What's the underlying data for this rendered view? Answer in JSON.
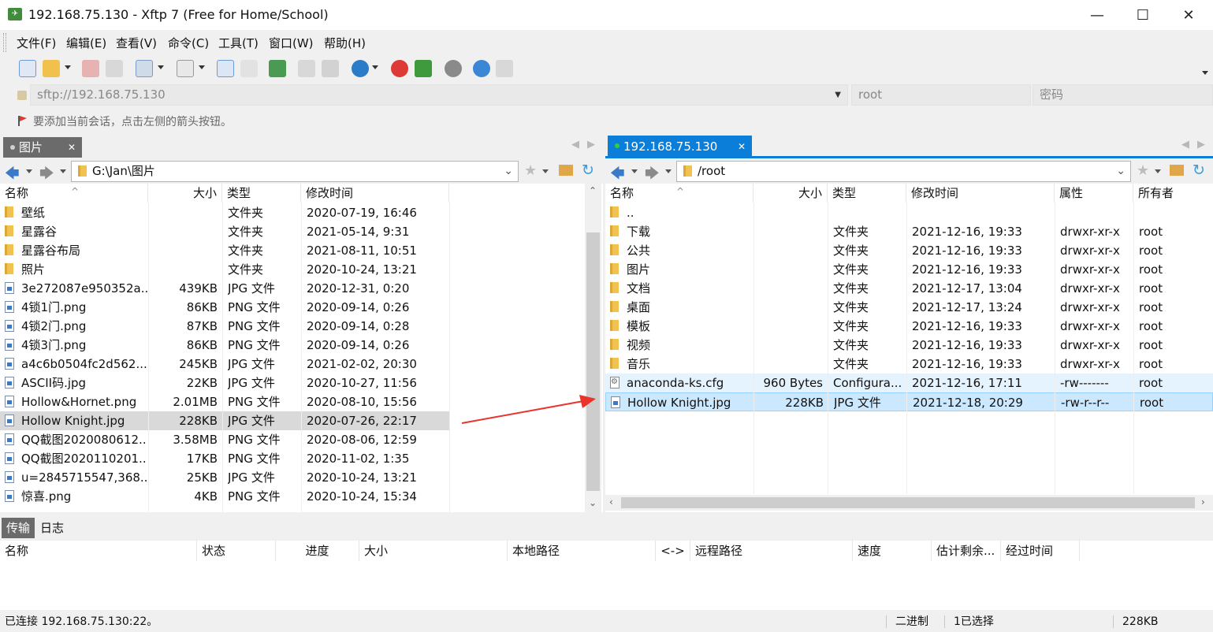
{
  "window": {
    "title": "192.168.75.130 - Xftp 7 (Free for Home/School)",
    "app_icon": "xftp-app-icon"
  },
  "menu": [
    "文件(F)",
    "编辑(E)",
    "查看(V)",
    "命令(C)",
    "工具(T)",
    "窗口(W)",
    "帮助(H)"
  ],
  "address": {
    "url": "sftp://192.168.75.130",
    "user": "root",
    "password_placeholder": "密码"
  },
  "hint": "要添加当前会话，点击左侧的箭头按钮。",
  "left": {
    "tab": "图片",
    "path": "G:\\Jan\\图片",
    "columns": [
      "名称",
      "大小",
      "类型",
      "修改时间"
    ],
    "rows": [
      {
        "icon": "folder",
        "name": "壁纸",
        "size": "",
        "type": "文件夹",
        "time": "2020-07-19, 16:46"
      },
      {
        "icon": "folder",
        "name": "星露谷",
        "size": "",
        "type": "文件夹",
        "time": "2021-05-14, 9:31"
      },
      {
        "icon": "folder",
        "name": "星露谷布局",
        "size": "",
        "type": "文件夹",
        "time": "2021-08-11, 10:51"
      },
      {
        "icon": "folder",
        "name": "照片",
        "size": "",
        "type": "文件夹",
        "time": "2020-10-24, 13:21"
      },
      {
        "icon": "file",
        "name": "3e272087e950352a...",
        "size": "439KB",
        "type": "JPG 文件",
        "time": "2020-12-31, 0:20"
      },
      {
        "icon": "file",
        "name": "4锁1门.png",
        "size": "86KB",
        "type": "PNG 文件",
        "time": "2020-09-14, 0:26"
      },
      {
        "icon": "file",
        "name": "4锁2门.png",
        "size": "87KB",
        "type": "PNG 文件",
        "time": "2020-09-14, 0:28"
      },
      {
        "icon": "file",
        "name": "4锁3门.png",
        "size": "86KB",
        "type": "PNG 文件",
        "time": "2020-09-14, 0:26"
      },
      {
        "icon": "file",
        "name": "a4c6b0504fc2d562...",
        "size": "245KB",
        "type": "JPG 文件",
        "time": "2021-02-02, 20:30"
      },
      {
        "icon": "file",
        "name": "ASCII码.jpg",
        "size": "22KB",
        "type": "JPG 文件",
        "time": "2020-10-27, 11:56"
      },
      {
        "icon": "file",
        "name": "Hollow&Hornet.png",
        "size": "2.01MB",
        "type": "PNG 文件",
        "time": "2020-08-10, 15:56"
      },
      {
        "icon": "file",
        "name": "Hollow Knight.jpg",
        "size": "228KB",
        "type": "JPG 文件",
        "time": "2020-07-26, 22:17",
        "selected": true
      },
      {
        "icon": "file",
        "name": "QQ截图2020080612...",
        "size": "3.58MB",
        "type": "PNG 文件",
        "time": "2020-08-06, 12:59"
      },
      {
        "icon": "file",
        "name": "QQ截图2020110201...",
        "size": "17KB",
        "type": "PNG 文件",
        "time": "2020-11-02, 1:35"
      },
      {
        "icon": "file",
        "name": "u=2845715547,368...",
        "size": "25KB",
        "type": "JPG 文件",
        "time": "2020-10-24, 13:21"
      },
      {
        "icon": "file",
        "name": "惊喜.png",
        "size": "4KB",
        "type": "PNG 文件",
        "time": "2020-10-24, 15:34"
      }
    ]
  },
  "right": {
    "tab": "192.168.75.130",
    "path": "/root",
    "columns": [
      "名称",
      "大小",
      "类型",
      "修改时间",
      "属性",
      "所有者"
    ],
    "rows": [
      {
        "icon": "folder",
        "name": "..",
        "size": "",
        "type": "",
        "time": "",
        "attr": "",
        "owner": ""
      },
      {
        "icon": "folder",
        "name": "下载",
        "size": "",
        "type": "文件夹",
        "time": "2021-12-16, 19:33",
        "attr": "drwxr-xr-x",
        "owner": "root"
      },
      {
        "icon": "folder",
        "name": "公共",
        "size": "",
        "type": "文件夹",
        "time": "2021-12-16, 19:33",
        "attr": "drwxr-xr-x",
        "owner": "root"
      },
      {
        "icon": "folder",
        "name": "图片",
        "size": "",
        "type": "文件夹",
        "time": "2021-12-16, 19:33",
        "attr": "drwxr-xr-x",
        "owner": "root"
      },
      {
        "icon": "folder",
        "name": "文档",
        "size": "",
        "type": "文件夹",
        "time": "2021-12-17, 13:04",
        "attr": "drwxr-xr-x",
        "owner": "root"
      },
      {
        "icon": "folder",
        "name": "桌面",
        "size": "",
        "type": "文件夹",
        "time": "2021-12-17, 13:24",
        "attr": "drwxr-xr-x",
        "owner": "root"
      },
      {
        "icon": "folder",
        "name": "模板",
        "size": "",
        "type": "文件夹",
        "time": "2021-12-16, 19:33",
        "attr": "drwxr-xr-x",
        "owner": "root"
      },
      {
        "icon": "folder",
        "name": "视频",
        "size": "",
        "type": "文件夹",
        "time": "2021-12-16, 19:33",
        "attr": "drwxr-xr-x",
        "owner": "root"
      },
      {
        "icon": "folder",
        "name": "音乐",
        "size": "",
        "type": "文件夹",
        "time": "2021-12-16, 19:33",
        "attr": "drwxr-xr-x",
        "owner": "root"
      },
      {
        "icon": "cfg",
        "name": "anaconda-ks.cfg",
        "size": "960 Bytes",
        "type": "Configura...",
        "time": "2021-12-16, 17:11",
        "attr": "-rw-------",
        "owner": "root",
        "hover": true
      },
      {
        "icon": "file",
        "name": "Hollow Knight.jpg",
        "size": "228KB",
        "type": "JPG 文件",
        "time": "2021-12-18, 20:29",
        "attr": "-rw-r--r--",
        "owner": "root",
        "selected": true
      }
    ]
  },
  "bottom_tabs": [
    "传输",
    "日志"
  ],
  "transfer_columns": [
    "名称",
    "状态",
    "进度",
    "大小",
    "本地路径",
    "<->",
    "远程路径",
    "速度",
    "估计剩余...",
    "经过时间"
  ],
  "status": {
    "connection": "已连接 192.168.75.130:22。",
    "mode": "二进制",
    "selection": "1已选择",
    "size": "228KB"
  },
  "colors": {
    "active_tab": "#0a7ed8",
    "inactive_tab": "#6b6b6b",
    "arrow": "#e8342c"
  }
}
